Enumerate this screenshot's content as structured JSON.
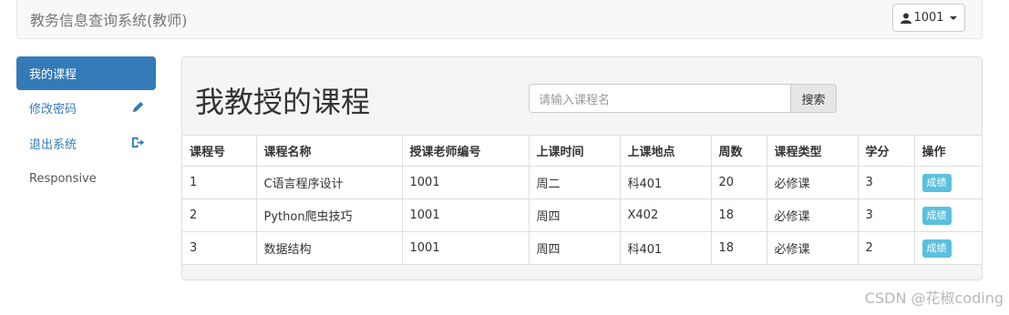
{
  "navbar": {
    "brand": "教务信息查询系统(教师)",
    "user_label": "1001"
  },
  "sidebar": {
    "items": [
      {
        "label": "我的课程",
        "icon": "",
        "active": true
      },
      {
        "label": "修改密码",
        "icon": "pencil-icon"
      },
      {
        "label": "退出系统",
        "icon": "logout-icon"
      },
      {
        "label": "Responsive",
        "icon": ""
      }
    ]
  },
  "main": {
    "title": "我教授的课程",
    "search": {
      "placeholder": "请输入课程名",
      "button": "搜索"
    },
    "table": {
      "headers": [
        "课程号",
        "课程名称",
        "授课老师编号",
        "上课时间",
        "上课地点",
        "周数",
        "课程类型",
        "学分",
        "操作"
      ],
      "rows": [
        [
          "1",
          "C语言程序设计",
          "1001",
          "周二",
          "科401",
          "20",
          "必修课",
          "3",
          "成绩"
        ],
        [
          "2",
          "Python爬虫技巧",
          "1001",
          "周四",
          "X402",
          "18",
          "必修课",
          "3",
          "成绩"
        ],
        [
          "3",
          "数据结构",
          "1001",
          "周四",
          "科401",
          "18",
          "必修课",
          "2",
          "成绩"
        ]
      ]
    }
  },
  "watermark": "CSDN @花椒coding",
  "colors": {
    "primary": "#337ab7",
    "info": "#5bc0de",
    "navbar_bg": "#f8f8f8"
  }
}
